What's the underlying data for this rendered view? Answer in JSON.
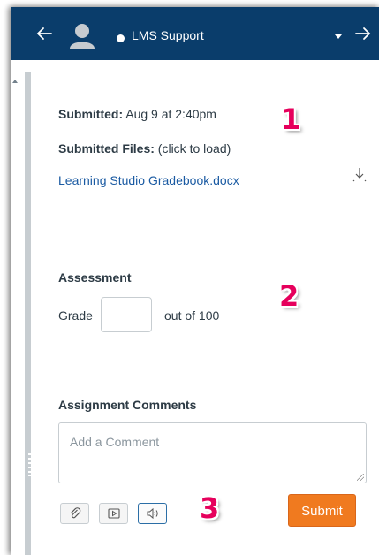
{
  "header": {
    "student_name": "LMS Support",
    "back_icon": "arrow-left-icon",
    "next_icon": "arrow-right-icon",
    "avatar_icon": "user-avatar-icon"
  },
  "submission": {
    "submitted_label": "Submitted:",
    "submitted_value": "Aug 9 at 2:40pm",
    "files_label": "Submitted Files:",
    "files_hint": "(click to load)",
    "file_name": "Learning Studio Gradebook.docx",
    "download_icon": "download-icon"
  },
  "assessment": {
    "heading": "Assessment",
    "grade_label": "Grade",
    "grade_value": "",
    "out_of": "out of 100"
  },
  "comments": {
    "heading": "Assignment Comments",
    "placeholder": "Add a Comment",
    "attach_icon": "paperclip-icon",
    "media_icon": "media-play-icon",
    "speech_icon": "speech-audio-icon",
    "submit_label": "Submit"
  },
  "callouts": {
    "one": "1",
    "two": "2",
    "three": "3"
  },
  "colors": {
    "header_bg": "#0a3d6b",
    "link": "#1a5aa2",
    "submit_bg": "#f07a1f",
    "callout": "#e6005c"
  }
}
